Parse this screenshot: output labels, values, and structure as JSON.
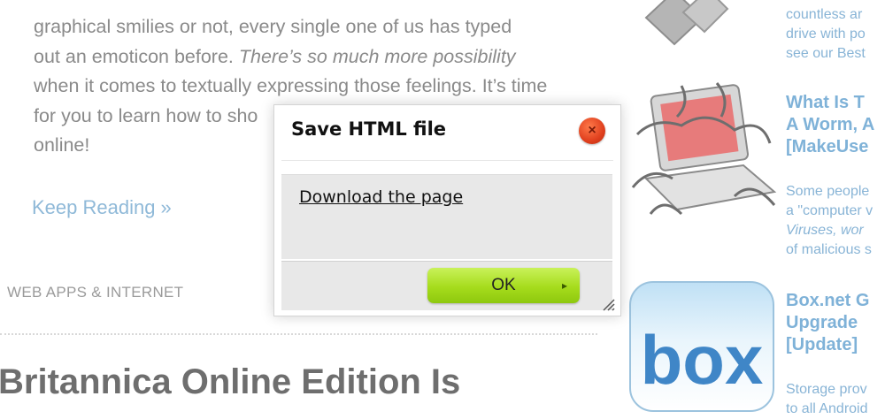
{
  "article": {
    "intro_line1": "graphical smilies or not, every single one of us has typed",
    "intro_line2a": "out an emoticon before. ",
    "intro_line2b": "There’s so much more possibility",
    "intro_line3": "when it comes to textually expressing those feelings. It’s time",
    "intro_line4": "for you to learn how to sho",
    "intro_line5": "online!",
    "keep_reading": "Keep Reading »",
    "category": "WEB APPS & INTERNET",
    "headline": "Britannica Online Edition Is"
  },
  "sidebar": {
    "item1": {
      "desc_line1": "countless ar",
      "desc_line2": "drive with po",
      "desc_line3": "see our Best"
    },
    "item2": {
      "title_line1": "What Is T",
      "title_line2": "A Worm, A",
      "title_line3": "[MakeUse",
      "desc_line1": "Some people",
      "desc_line2": "a \"computer v",
      "desc_line3a": "Viruses",
      "desc_line3b": ", wor",
      "desc_line4": "of malicious s"
    },
    "item3": {
      "thumb_text": "box",
      "title_line1": "Box.net G",
      "title_line2": "Upgrade",
      "title_line3": "[Update]",
      "desc_line1": "Storage prov",
      "desc_line2": "to all Android"
    }
  },
  "modal": {
    "title": "Save HTML file",
    "close_glyph": "×",
    "download_link": "Download the page",
    "ok_label": "OK",
    "ok_arrow": "▸"
  },
  "colors": {
    "link_blue": "#7fb2d8",
    "ok_green": "#a6dc1c",
    "close_red": "#e0401e"
  }
}
